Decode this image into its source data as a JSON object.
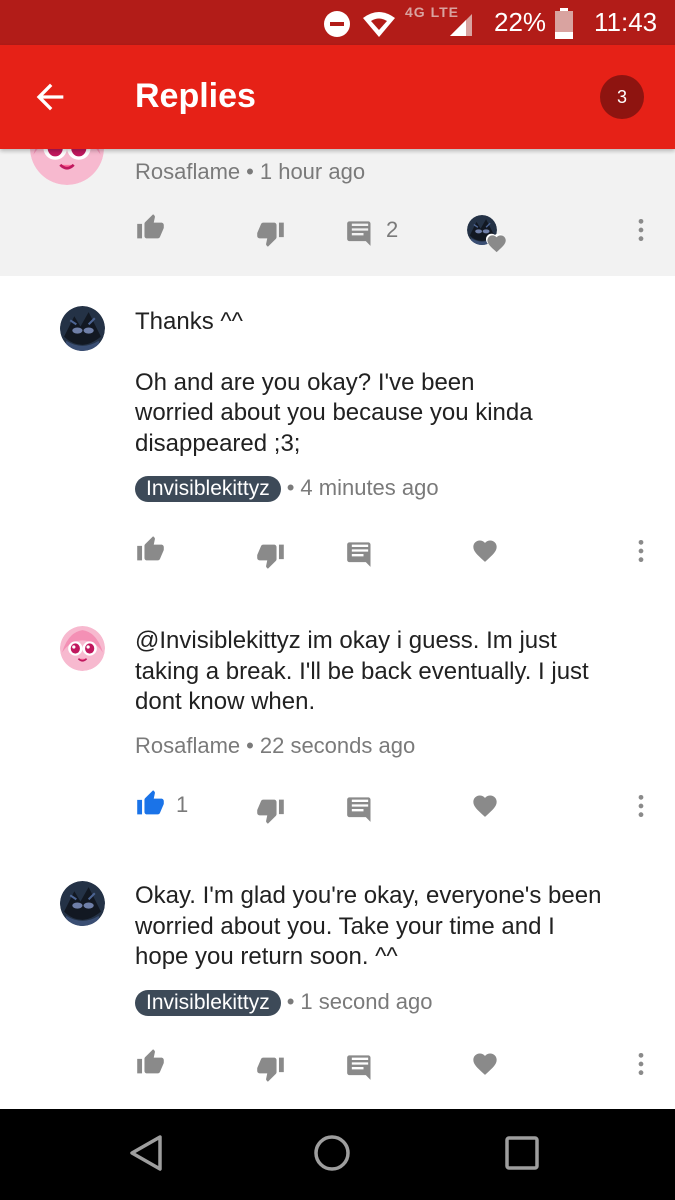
{
  "status_bar": {
    "network_label": "4G LTE",
    "battery": "22%",
    "time": "11:43",
    "icons": [
      "do-not-disturb-icon",
      "wifi-icon",
      "signal-icon",
      "battery-icon"
    ]
  },
  "app_bar": {
    "title": "Replies",
    "badge": "3",
    "back_icon": "arrow-left-icon",
    "color": "#e62117"
  },
  "parent_comment": {
    "author": "Rosaflame",
    "time": "1 hour ago",
    "reply_count": "2"
  },
  "replies": [
    {
      "author": "Invisiblekittyz",
      "author_highlighted": true,
      "time": "4 minutes ago",
      "text_1": "Thanks ^^",
      "text_2": "Oh and are you okay? I've been\nworried about you because you kinda\ndisappeared ;3;"
    },
    {
      "author": "Rosaflame",
      "author_highlighted": false,
      "time": "22 seconds ago",
      "text_1": "@Invisiblekittyz im okay i guess. Im just\ntaking a break. I'll be back eventually. I just\ndont know when.",
      "like_count": "1",
      "liked": true
    },
    {
      "author": "Invisiblekittyz",
      "author_highlighted": true,
      "time": "1 second ago",
      "text_1": "Okay. I'm glad you're okay, everyone's been\nworried about you. Take your time and I\nhope you return soon. ^^"
    }
  ],
  "nav_bar": {
    "icons": [
      "back-triangle-icon",
      "home-circle-icon",
      "recents-square-icon"
    ]
  },
  "colors": {
    "status_bar": "#b21c18",
    "accent_like": "#1a73e8",
    "chip": "#3d4a58"
  }
}
